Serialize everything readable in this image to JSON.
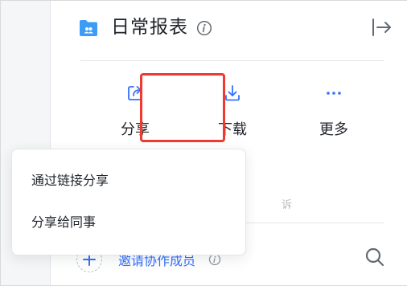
{
  "header": {
    "title": "日常报表",
    "icons": {
      "folder": "shared-folder-icon",
      "info": "info-icon",
      "exit": "exit-panel-icon"
    }
  },
  "actions": [
    {
      "label": "分享",
      "icon": "share-icon",
      "highlighted": true
    },
    {
      "label": "下载",
      "icon": "download-icon"
    },
    {
      "label": "更多",
      "icon": "more-icon"
    }
  ],
  "popup_menu": {
    "items": [
      {
        "label": "通过链接分享"
      },
      {
        "label": "分享给同事"
      }
    ]
  },
  "members": {
    "obscured_text": "诉",
    "invite_label": "邀请协作成员",
    "icons": {
      "add": "plus-icon",
      "info": "info-icon",
      "search": "search-icon"
    }
  },
  "colors": {
    "accent": "#3370ff",
    "highlight_border": "#f03a2e",
    "folder": "#3370ff",
    "text": "#1f2329"
  }
}
